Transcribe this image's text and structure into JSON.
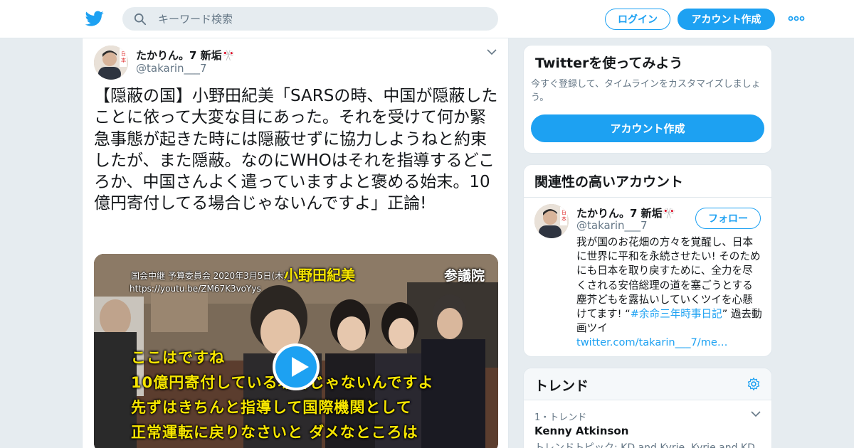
{
  "header": {
    "search_placeholder": "キーワード検索",
    "login_label": "ログイン",
    "signup_label": "アカウント作成"
  },
  "tweet": {
    "user_name": "たかりん。7 新垢🎌",
    "user_handle": "@takarin___7",
    "text": "【隠蔽の国】小野田紀美「SARSの時、中国が隠蔽したことに依って大変な目にあった。それを受けて何か緊急事態が起きた時には隠蔽せずに協力しようねと約束したが、また隠蔽。なのにWHOはそれを指導するどころか、中国さんよく遣っていますよと褒める始末。10億円寄付してる場合じゃないんですよ」正論!",
    "media": {
      "caption_top": "国会中継 予算委員会 2020年3月5日(木)",
      "caption_url": "https://youtu.be/ZM67K3voYys",
      "caption_name": "小野田紀美",
      "caption_house": "参議院",
      "subtitles": [
        "ここはですね",
        "10億円寄付している場合じゃないんですよ",
        "先ずはきちんと指導して国際機関として",
        "正常運転に戻りなさいと ダメなところは"
      ]
    }
  },
  "signup_panel": {
    "title": "Twitterを使ってみよう",
    "description": "今すぐ登録して、タイムラインをカスタマイズしましょう。",
    "cta_label": "アカウント作成"
  },
  "related_panel": {
    "title": "関連性の高いアカウント",
    "account": {
      "name": "たかりん。7 新垢🎌",
      "handle": "@takarin___7",
      "follow_label": "フォロー",
      "bio_text": "我が国のお花畑の方々を覚醒し、日本に世界に平和を永続させたい! そのためにも日本を取り戻すために、全力を尽くされる安倍総理の道を塞ごうとする塵芥どもを露払いしていくツイを心懸けてます! “",
      "bio_hashtag": "#余命三年時事日記",
      "bio_after": "” 過去動画ツイ",
      "bio_link": "twitter.com/takarin___7/me…"
    }
  },
  "trends_panel": {
    "title": "トレンド",
    "items": [
      {
        "meta": "1・トレンド",
        "name": "Kenny Atkinson",
        "topic": "トレンドトピック: KD and Kyrie, Kyrie and KD"
      }
    ]
  },
  "colors": {
    "accent": "#1da1f2",
    "background": "#e6ecf0",
    "subtitle_yellow": "#f7e600"
  }
}
